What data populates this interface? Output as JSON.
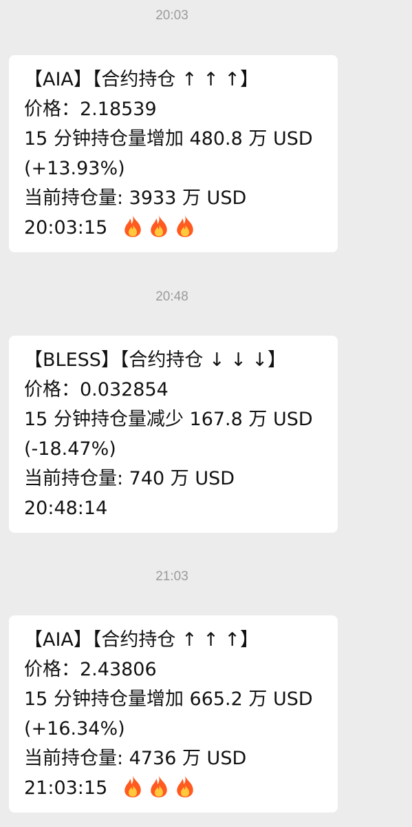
{
  "messages": [
    {
      "time": "20:03",
      "lines": [
        "【AIA】【合约持仓 ↑ ↑ ↑】",
        "价格：2.18539",
        "15 分钟持仓量增加 480.8 万 USD",
        "(+13.93%)",
        "当前持仓量: 3933 万 USD",
        "20:03:15"
      ],
      "fire_count": 3
    },
    {
      "time": "20:48",
      "lines": [
        "【BLESS】【合约持仓 ↓ ↓ ↓】",
        "价格：0.032854",
        "15 分钟持仓量减少 167.8 万 USD",
        "(-18.47%)",
        "当前持仓量: 740 万 USD",
        "20:48:14"
      ],
      "fire_count": 0
    },
    {
      "time": "21:03",
      "lines": [
        "【AIA】【合约持仓 ↑ ↑ ↑】",
        "价格：2.43806",
        "15 分钟持仓量增加 665.2 万 USD",
        "(+16.34%)",
        "当前持仓量: 4736 万 USD",
        "21:03:15"
      ],
      "fire_count": 3
    }
  ],
  "colors": {
    "background": "#ececec",
    "bubble": "#ffffff",
    "timestamp": "#9a9a9a",
    "text": "#111111",
    "fire_outer": "#ff5a1f",
    "fire_inner": "#ffc83d"
  },
  "icons": {
    "fire": "fire-icon"
  }
}
